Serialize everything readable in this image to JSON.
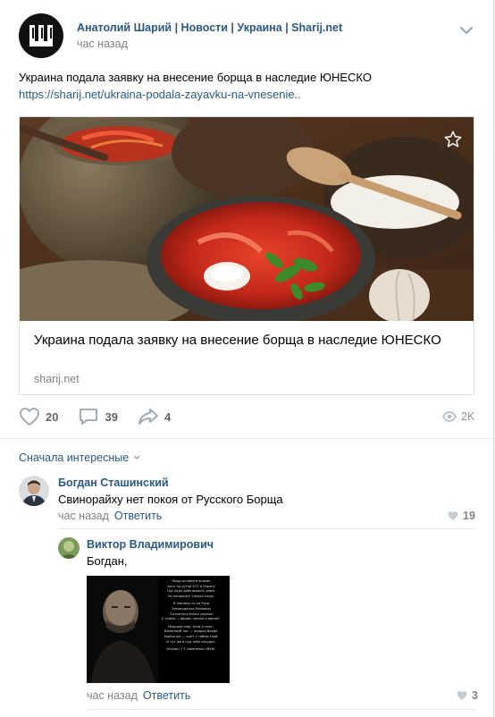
{
  "post": {
    "group_name": "Анатолий Шарий | Новости | Украина | Sharij.net",
    "time": "час назад",
    "text": "Украина подала заявку на внесение борща в наследие ЮНЕСКО",
    "link": "https://sharij.net/ukraina-podala-zayavku-na-vnesenie..",
    "logo_letter": "Ш"
  },
  "snippet": {
    "title": "Украина подала заявку на внесение борща в наследие ЮНЕСКО",
    "domain": "sharij.net",
    "icon": "star-icon"
  },
  "actions": {
    "likes": "20",
    "comments": "39",
    "shares": "4",
    "views": "2K"
  },
  "comments_sort": "Сначала интересные",
  "comments": [
    {
      "author": "Богдан Сташинский",
      "text": "Свинорайху нет покоя от Русского Борща",
      "time": "час назад",
      "reply_label": "Ответить",
      "likes": "19"
    }
  ],
  "replies": [
    {
      "author": "Виктор Владимирович",
      "text": "Богдан,",
      "time": "час назад",
      "reply_label": "Ответить",
      "likes": "3",
      "image_text": [
        "Якщо оставите осаємн",
        "Хоть ты ругни ЕГО в Європу",
        "Где надо действовать умом,",
        "Не напрягает только нашу.",
        "",
        "Я поливку-то на Руси",
        "Законодатые Моховым",
        "\"Сольеться блоки украли!",
        "С тремя — видом, землю и вином\".",
        "",
        "Народом мир, если и слое ;",
        "Финанный лес — подряд блоде.",
        "Хорош же — сыет с тобою злой,",
        "И тут же в суд тебя насудит.",
        "",
        "«Козак» Т.Г.Шевченко 1856г."
      ]
    }
  ]
}
